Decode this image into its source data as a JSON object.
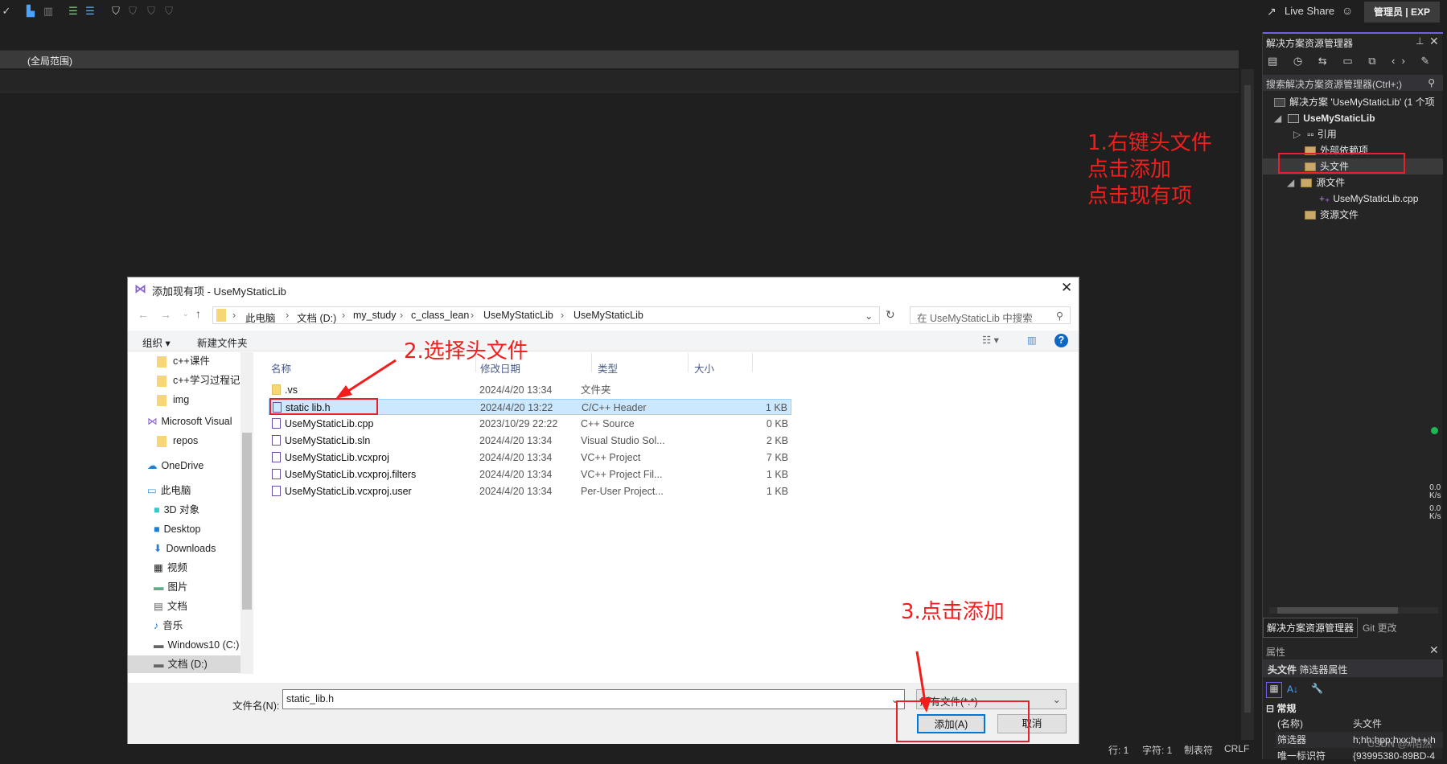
{
  "toolbar": {
    "icons": [
      "spellcheck-icon",
      "cursor-icon",
      "column-icon",
      "indent-icon",
      "outdent-icon",
      "bookmark-icon",
      "bookmark-prev-icon",
      "bookmark-next-icon",
      "bookmark-clear-icon"
    ],
    "live_share": "Live Share",
    "admin_badge": "管理员 | EXP"
  },
  "editor": {
    "scope": "(全局范围)"
  },
  "status": {
    "line": "行: 1",
    "char": "字符: 1",
    "tab": "制表符",
    "eol": "CRLF"
  },
  "solution_explorer": {
    "title": "解决方案资源管理器",
    "search_placeholder": "搜索解决方案资源管理器(Ctrl+;)",
    "tree": [
      {
        "label": "解决方案 'UseMyStaticLib' (1 个项"
      },
      {
        "label": "UseMyStaticLib"
      },
      {
        "label": "引用"
      },
      {
        "label": "外部依赖项"
      },
      {
        "label": "头文件",
        "selected": true
      },
      {
        "label": "源文件"
      },
      {
        "label": "UseMyStaticLib.cpp"
      },
      {
        "label": "资源文件"
      }
    ],
    "tabs": [
      "解决方案资源管理器",
      "Git 更改"
    ]
  },
  "properties": {
    "title": "属性",
    "object": "头文件",
    "object_type": "筛选器属性",
    "category": "常规",
    "rows": [
      {
        "name": "(名称)",
        "value": "头文件"
      },
      {
        "name": "筛选器",
        "value": "h;hh;hpp;hxx;h++;h"
      },
      {
        "name": "唯一标识符",
        "value": "{93995380-89BD-4"
      }
    ]
  },
  "network": {
    "up": "0.0",
    "down": "0.0",
    "unit": "K/s"
  },
  "annotations": {
    "step1": [
      "1.右键头文件",
      "点击添加",
      "点击现有项"
    ],
    "step2": "2.选择头文件",
    "step3": "3.点击添加",
    "color": "#f21d1d"
  },
  "watermark": "CSDN @#陌然",
  "dialog": {
    "title": "添加现有项 - UseMyStaticLib",
    "breadcrumb": [
      "此电脑",
      "文档 (D:)",
      "my_study",
      "c_class_lean",
      "UseMyStaticLib",
      "UseMyStaticLib"
    ],
    "search_placeholder": "在 UseMyStaticLib 中搜索",
    "organize": "组织 ▾",
    "new_folder": "新建文件夹",
    "nav": [
      "c++课件",
      "c++学习过程记录",
      "img",
      "Microsoft Visual",
      "repos",
      "OneDrive",
      "此电脑",
      "3D 对象",
      "Desktop",
      "Downloads",
      "视频",
      "图片",
      "文档",
      "音乐",
      "Windows10 (C:)",
      "文档 (D:)"
    ],
    "columns": [
      "名称",
      "修改日期",
      "类型",
      "大小"
    ],
    "files": [
      {
        "name": ".vs",
        "date": "2024/4/20 13:34",
        "type": "文件夹",
        "size": ""
      },
      {
        "name": "static lib.h",
        "date": "2024/4/20 13:22",
        "type": "C/C++ Header",
        "size": "1 KB",
        "selected": true
      },
      {
        "name": "UseMyStaticLib.cpp",
        "date": "2023/10/29 22:22",
        "type": "C++ Source",
        "size": "0 KB"
      },
      {
        "name": "UseMyStaticLib.sln",
        "date": "2024/4/20 13:34",
        "type": "Visual Studio Sol...",
        "size": "2 KB"
      },
      {
        "name": "UseMyStaticLib.vcxproj",
        "date": "2024/4/20 13:34",
        "type": "VC++ Project",
        "size": "7 KB"
      },
      {
        "name": "UseMyStaticLib.vcxproj.filters",
        "date": "2024/4/20 13:34",
        "type": "VC++ Project Fil...",
        "size": "1 KB"
      },
      {
        "name": "UseMyStaticLib.vcxproj.user",
        "date": "2024/4/20 13:34",
        "type": "Per-User Project...",
        "size": "1 KB"
      }
    ],
    "filename_label": "文件名(N):",
    "filename_value": "static_lib.h",
    "filter": "所有文件(*.*)",
    "add": "添加(A)",
    "cancel": "取消"
  }
}
